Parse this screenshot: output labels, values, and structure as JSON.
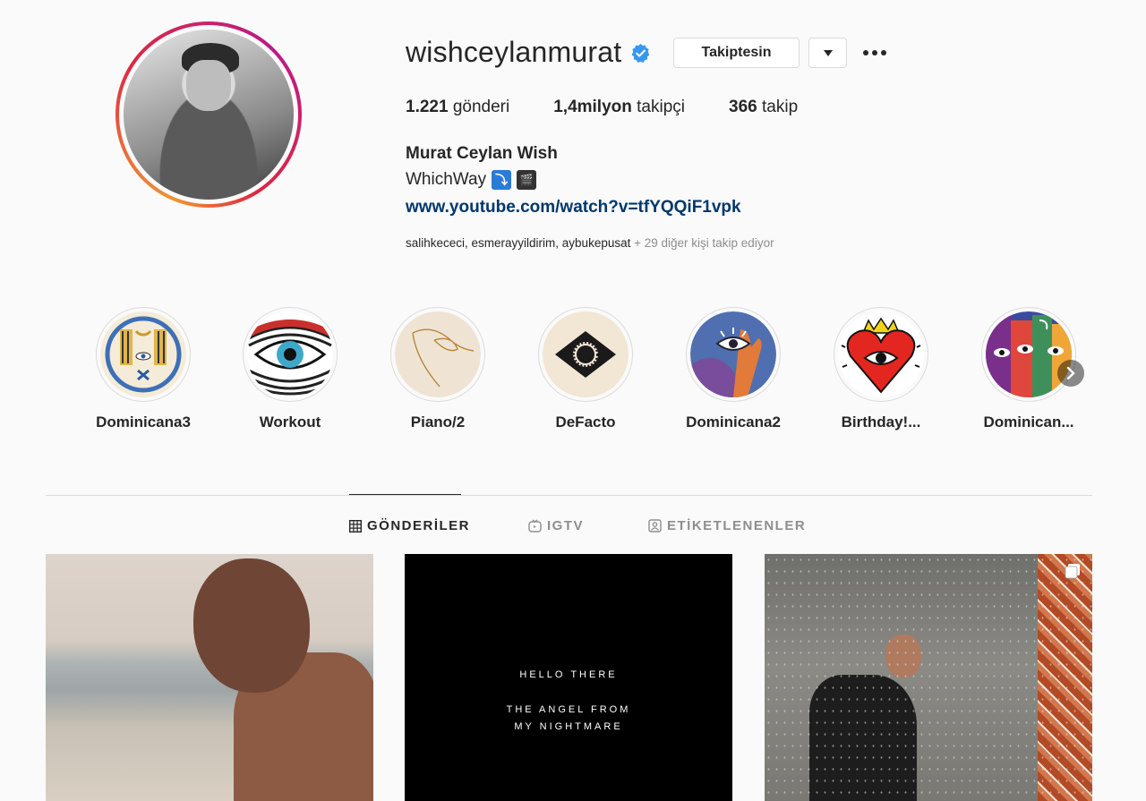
{
  "profile": {
    "username": "wishceylanmurat",
    "follow_button_label": "Takiptesin",
    "stats": {
      "posts_count": "1.221",
      "posts_label": "gönderi",
      "followers_count": "1,4milyon",
      "followers_label": "takipçi",
      "following_count": "366",
      "following_label": "takip"
    },
    "full_name": "Murat Ceylan Wish",
    "bio_text": "WhichWay",
    "bio_emoji_1": "⤵",
    "bio_emoji_2": "🎬",
    "link": "www.youtube.com/watch?v=tfYQQiF1vpk",
    "followed_by_names": "salihkececi, esmerayyildirim, aybukepusat",
    "followed_by_more": " + 29 diğer kişi takip ediyor"
  },
  "highlights": [
    {
      "label": "Dominicana3",
      "icon": "moon-hands-highlight"
    },
    {
      "label": "Workout",
      "icon": "striped-eye-highlight"
    },
    {
      "label": "Piano/2",
      "icon": "line-drawing-highlight"
    },
    {
      "label": "DeFacto",
      "icon": "black-eye-highlight"
    },
    {
      "label": "Dominicana2",
      "icon": "hands-eye-highlight"
    },
    {
      "label": "Birthday!...",
      "icon": "heart-eye-highlight"
    },
    {
      "label": "Dominican...",
      "icon": "colorful-eyes-highlight"
    }
  ],
  "tabs": [
    {
      "label": "GÖNDERİLER",
      "icon": "grid-icon",
      "active": true
    },
    {
      "label": "IGTV",
      "icon": "igtv-icon",
      "active": false
    },
    {
      "label": "ETİKETLENENLER",
      "icon": "tagged-icon",
      "active": false
    }
  ],
  "posts": {
    "post2_line1": "HELLO THERE",
    "post2_line2": "THE ANGEL FROM",
    "post2_line3": "MY NIGHTMARE"
  },
  "colors": {
    "link": "#00376b",
    "verified": "#3897f0",
    "muted": "#8e8e8e",
    "border": "#dbdbdb"
  }
}
